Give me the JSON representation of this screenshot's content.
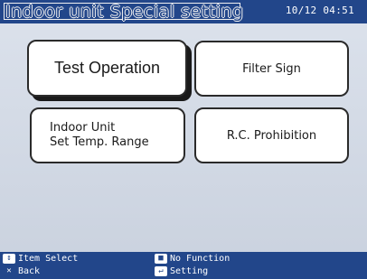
{
  "header": {
    "title": "Indoor unit Special setting",
    "clock": "10/12 04:51"
  },
  "menu": {
    "test_operation": "Test Operation",
    "filter_sign": "Filter Sign",
    "set_temp_range": "Indoor Unit\nSet Temp. Range",
    "rc_prohibition": "R.C. Prohibition",
    "selected": "test_operation"
  },
  "help": {
    "item_select": "Item Select",
    "back": "Back",
    "no_function": "No Function",
    "setting": "Setting",
    "icons": {
      "item_select": "dpad-icon",
      "back": "back-icon",
      "no_function": "menu-key-icon",
      "setting": "enter-icon"
    }
  },
  "colors": {
    "bar": "#22468a",
    "screen": "#cfd6e2"
  }
}
